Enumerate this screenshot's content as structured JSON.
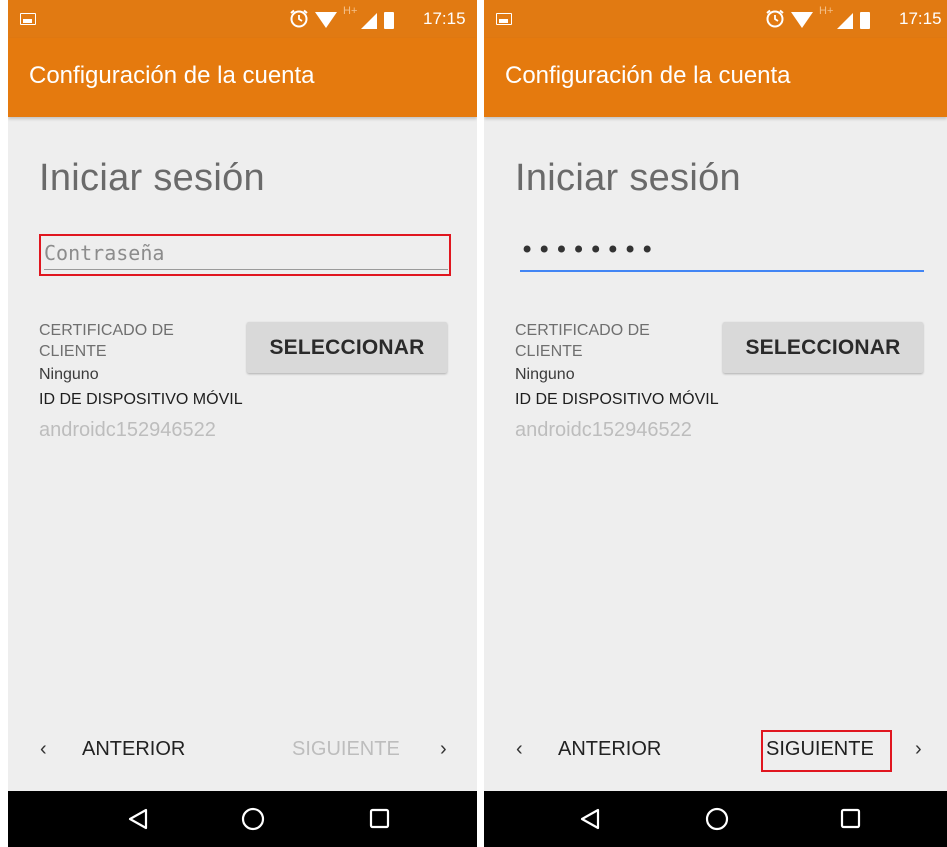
{
  "colors": {
    "app_bar": "#e57a0e",
    "status_bar": "#e17a12",
    "background": "#eeeeee",
    "highlight": "#e0161f",
    "focus_underline": "#4285f4"
  },
  "screens": [
    {
      "status_bar": {
        "time": "17:15",
        "icons": [
          "gallery-icon",
          "alarm-icon",
          "wifi-icon",
          "hplus-icon",
          "signal-icon",
          "battery-icon"
        ]
      },
      "app_bar": {
        "title": "Configuración de la cuenta"
      },
      "page_title": "Iniciar sesión",
      "password": {
        "placeholder": "Contraseña",
        "value": "",
        "focused": false,
        "highlighted": true
      },
      "client_certificate": {
        "label": "CERTIFICADO DE CLIENTE",
        "value": "Ninguno"
      },
      "select_button": "SELECCIONAR",
      "device_id": {
        "label": "ID DE DISPOSITIVO MÓVIL",
        "value": "androidc152946522"
      },
      "nav": {
        "previous": "ANTERIOR",
        "next": "SIGUIENTE",
        "next_enabled": false,
        "next_highlighted": false
      }
    },
    {
      "status_bar": {
        "time": "17:15",
        "icons": [
          "gallery-icon",
          "alarm-icon",
          "wifi-icon",
          "hplus-icon",
          "signal-icon",
          "battery-icon"
        ]
      },
      "app_bar": {
        "title": "Configuración de la cuenta"
      },
      "page_title": "Iniciar sesión",
      "password": {
        "placeholder": "Contraseña",
        "value": "••••••••",
        "focused": true,
        "highlighted": false
      },
      "client_certificate": {
        "label": "CERTIFICADO DE CLIENTE",
        "value": "Ninguno"
      },
      "select_button": "SELECCIONAR",
      "device_id": {
        "label": "ID DE DISPOSITIVO MÓVIL",
        "value": "androidc152946522"
      },
      "nav": {
        "previous": "ANTERIOR",
        "next": "SIGUIENTE",
        "next_enabled": true,
        "next_highlighted": true
      }
    }
  ],
  "system_nav": {
    "icons": [
      "back-icon",
      "home-icon",
      "recents-icon"
    ]
  }
}
